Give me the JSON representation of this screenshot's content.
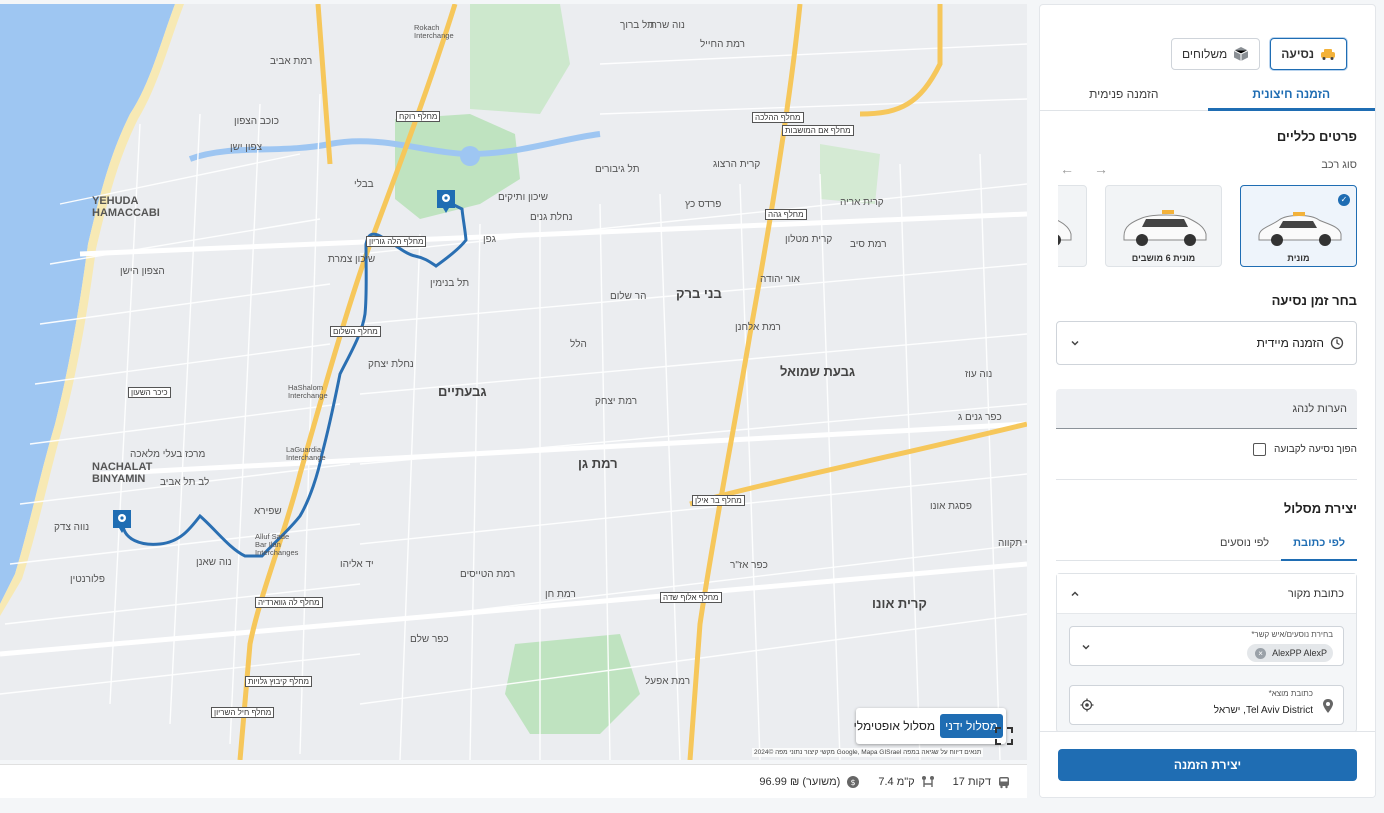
{
  "map": {
    "districts": [
      {
        "name": "district-yehuda",
        "text": "YEHUDA\nHAMACCABI"
      },
      {
        "name": "district-nachalat",
        "text": "NACHALAT\nBINYAMIN"
      }
    ],
    "big_labels": [
      "גבעתיים",
      "רמת גן",
      "בני ברק",
      "גבעת שמואל",
      "קרית אונו"
    ],
    "labels": [
      "רמת אביב",
      "צפון ישן",
      "כוכב הצפון",
      "בבלי",
      "תל ברוך",
      "נוה שרת",
      "רמת החייל",
      "שיכון ותיקים",
      "נחלת גנים",
      "תל גיבורים",
      "פרדס כץ",
      "קרית הרצוג",
      "רמת סיב",
      "קרית מטלון",
      "גפן",
      "שיכון צמרת",
      "הצפון הישן",
      "תל בנימין",
      "הר שלום",
      "הלל",
      "נחלת יצחק",
      "רמת יצחק",
      "שפירא",
      "פלורנטין",
      "נווה צדק",
      "מרכז בעלי מלאכה",
      "לב תל אביב",
      "נוה שאנן",
      "יד אליהו",
      "רמת הטייסים",
      "כפר שלם",
      "רמת חן",
      "רמת אפעל",
      "נוה עוז",
      "כפר גנים ג",
      "קרית אריה",
      "אור יהודה",
      "רמת אלחנן",
      "כפר אז\"ר",
      "פסגת אונו",
      "גני תקווה"
    ],
    "boxes": [
      "מחלף רוקח",
      "מחלף הלה גוריון",
      "מחלף ההלכה",
      "מחלף גהה",
      "מחלף בר אילן",
      "מחלף אלוף שדה",
      "מחלף השלום",
      "מחלף לה גווארדיה",
      "מחלף קיבוץ גלויות",
      "מחלף חיל השריון",
      "מחלף אם המושבות",
      "כיכר השעון"
    ],
    "interchanges": [
      "Rokach\nInterchange",
      "HaShalom\nInterchange",
      "LaGuardia\nInterchange",
      "Alluf Sade\nBar Ilan\nInterchanges"
    ],
    "route_toggle": {
      "manual": "מסלול ידני",
      "optimal": "מסלול אופטימלי"
    },
    "attribution": "מקשי קיצור  נתוני מפה ©2024 Google, Mapa GISrael  תנאים  דיווח על שגיאה במפה",
    "route_color": "#1f6db3"
  },
  "footer": {
    "duration": "17 דקות",
    "distance": "7.4 ק\"מ",
    "price": "96.99 ₪ (משוער)"
  },
  "panel": {
    "ride_type_buttons": [
      {
        "label": "נסיעה",
        "icon": "taxi-icon",
        "active": true
      },
      {
        "label": "משלוחים",
        "icon": "package-icon",
        "active": false
      }
    ],
    "tabs": {
      "external": "הזמנה חיצונית",
      "internal": "הזמנה פנימית"
    },
    "general_title": "פרטים כלליים",
    "vehicle_label": "סוג רכב",
    "vehicles": [
      {
        "label": "מונית",
        "selected": true
      },
      {
        "label": "מונית 6 מושבים",
        "selected": false
      },
      {
        "label": "ו",
        "selected": false
      }
    ],
    "time_title": "בחר זמן נסיעה",
    "time_value": "הזמנה מיידית",
    "notes_placeholder": "הערות לנהג",
    "recurring_label": "הפוך נסיעה לקבועה",
    "route_title": "יצירת מסלול",
    "route_tabs": {
      "by_address": "לפי כתובת",
      "by_passengers": "לפי נוסעים"
    },
    "origin_title": "כתובת מקור",
    "passenger_field_label": "בחירת נוסעים/איש קשר*",
    "passenger_chip": "AlexPP AlexP",
    "origin_field_label": "כתובת מוצא*",
    "origin_value": "Tel Aviv District, ישראל",
    "create_button": "יצירת הזמנה",
    "accent_color": "#1f6db3"
  }
}
